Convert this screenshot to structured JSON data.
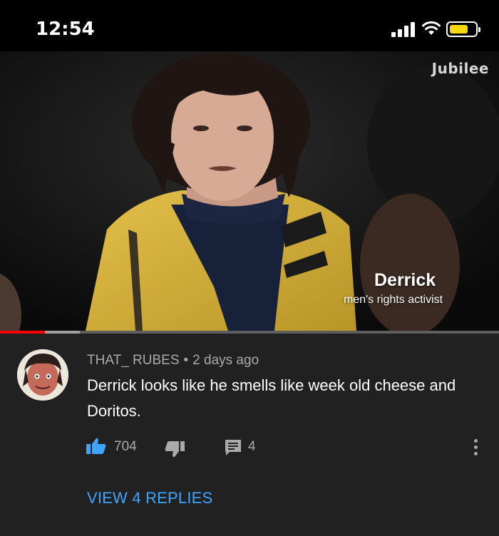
{
  "status_bar": {
    "time": "12:54",
    "battery_level": 0.7,
    "battery_color": "#f5d90a",
    "icons": [
      "signal-icon",
      "wifi-icon",
      "battery-icon"
    ]
  },
  "video": {
    "brand": "Jubilee",
    "caption": {
      "name": "Derrick",
      "role": "men's rights activist"
    },
    "progress": {
      "played_fraction": 0.09,
      "buffered_fraction": 0.16,
      "played_color": "#ff0000"
    }
  },
  "comment": {
    "author": "THAT_ RUBES",
    "separator": "•",
    "age": "2 days ago",
    "text": "Derrick looks like he smells like week old cheese and Doritos.",
    "like_count": "704",
    "reply_count": "4",
    "view_replies_label": "VIEW 4 REPLIES",
    "accent_color": "#3ea6ff",
    "icons": [
      "thumbs-up-icon",
      "thumbs-down-icon",
      "reply-icon",
      "more-vertical-icon"
    ]
  }
}
